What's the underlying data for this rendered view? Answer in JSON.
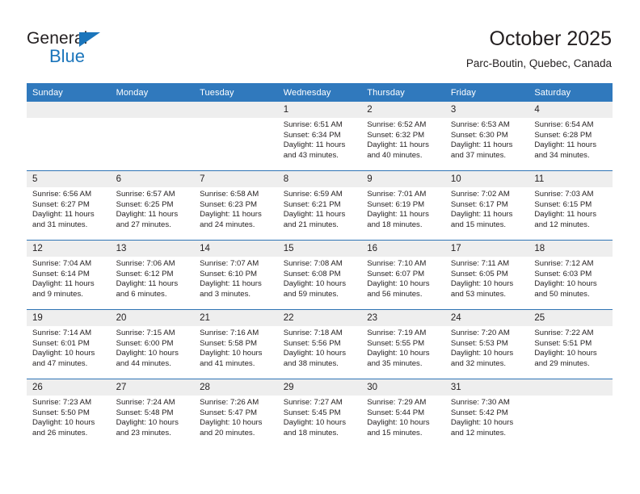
{
  "brand": {
    "name_top": "General",
    "name_bottom": "Blue",
    "accent_color": "#1b75bb",
    "text_color": "#231f20"
  },
  "header": {
    "title": "October 2025",
    "subtitle": "Parc-Boutin, Quebec, Canada"
  },
  "theme": {
    "header_row_bg": "#3079bd",
    "header_row_text": "#ffffff",
    "daynum_bg": "#eeeeee",
    "row_divider": "#2f74b5"
  },
  "weekdays": [
    "Sunday",
    "Monday",
    "Tuesday",
    "Wednesday",
    "Thursday",
    "Friday",
    "Saturday"
  ],
  "weeks": [
    [
      {
        "day": "",
        "blank": true
      },
      {
        "day": "",
        "blank": true
      },
      {
        "day": "",
        "blank": true
      },
      {
        "day": "1",
        "sunrise": "Sunrise: 6:51 AM",
        "sunset": "Sunset: 6:34 PM",
        "daylight_1": "Daylight: 11 hours",
        "daylight_2": "and 43 minutes."
      },
      {
        "day": "2",
        "sunrise": "Sunrise: 6:52 AM",
        "sunset": "Sunset: 6:32 PM",
        "daylight_1": "Daylight: 11 hours",
        "daylight_2": "and 40 minutes."
      },
      {
        "day": "3",
        "sunrise": "Sunrise: 6:53 AM",
        "sunset": "Sunset: 6:30 PM",
        "daylight_1": "Daylight: 11 hours",
        "daylight_2": "and 37 minutes."
      },
      {
        "day": "4",
        "sunrise": "Sunrise: 6:54 AM",
        "sunset": "Sunset: 6:28 PM",
        "daylight_1": "Daylight: 11 hours",
        "daylight_2": "and 34 minutes."
      }
    ],
    [
      {
        "day": "5",
        "sunrise": "Sunrise: 6:56 AM",
        "sunset": "Sunset: 6:27 PM",
        "daylight_1": "Daylight: 11 hours",
        "daylight_2": "and 31 minutes."
      },
      {
        "day": "6",
        "sunrise": "Sunrise: 6:57 AM",
        "sunset": "Sunset: 6:25 PM",
        "daylight_1": "Daylight: 11 hours",
        "daylight_2": "and 27 minutes."
      },
      {
        "day": "7",
        "sunrise": "Sunrise: 6:58 AM",
        "sunset": "Sunset: 6:23 PM",
        "daylight_1": "Daylight: 11 hours",
        "daylight_2": "and 24 minutes."
      },
      {
        "day": "8",
        "sunrise": "Sunrise: 6:59 AM",
        "sunset": "Sunset: 6:21 PM",
        "daylight_1": "Daylight: 11 hours",
        "daylight_2": "and 21 minutes."
      },
      {
        "day": "9",
        "sunrise": "Sunrise: 7:01 AM",
        "sunset": "Sunset: 6:19 PM",
        "daylight_1": "Daylight: 11 hours",
        "daylight_2": "and 18 minutes."
      },
      {
        "day": "10",
        "sunrise": "Sunrise: 7:02 AM",
        "sunset": "Sunset: 6:17 PM",
        "daylight_1": "Daylight: 11 hours",
        "daylight_2": "and 15 minutes."
      },
      {
        "day": "11",
        "sunrise": "Sunrise: 7:03 AM",
        "sunset": "Sunset: 6:15 PM",
        "daylight_1": "Daylight: 11 hours",
        "daylight_2": "and 12 minutes."
      }
    ],
    [
      {
        "day": "12",
        "sunrise": "Sunrise: 7:04 AM",
        "sunset": "Sunset: 6:14 PM",
        "daylight_1": "Daylight: 11 hours",
        "daylight_2": "and 9 minutes."
      },
      {
        "day": "13",
        "sunrise": "Sunrise: 7:06 AM",
        "sunset": "Sunset: 6:12 PM",
        "daylight_1": "Daylight: 11 hours",
        "daylight_2": "and 6 minutes."
      },
      {
        "day": "14",
        "sunrise": "Sunrise: 7:07 AM",
        "sunset": "Sunset: 6:10 PM",
        "daylight_1": "Daylight: 11 hours",
        "daylight_2": "and 3 minutes."
      },
      {
        "day": "15",
        "sunrise": "Sunrise: 7:08 AM",
        "sunset": "Sunset: 6:08 PM",
        "daylight_1": "Daylight: 10 hours",
        "daylight_2": "and 59 minutes."
      },
      {
        "day": "16",
        "sunrise": "Sunrise: 7:10 AM",
        "sunset": "Sunset: 6:07 PM",
        "daylight_1": "Daylight: 10 hours",
        "daylight_2": "and 56 minutes."
      },
      {
        "day": "17",
        "sunrise": "Sunrise: 7:11 AM",
        "sunset": "Sunset: 6:05 PM",
        "daylight_1": "Daylight: 10 hours",
        "daylight_2": "and 53 minutes."
      },
      {
        "day": "18",
        "sunrise": "Sunrise: 7:12 AM",
        "sunset": "Sunset: 6:03 PM",
        "daylight_1": "Daylight: 10 hours",
        "daylight_2": "and 50 minutes."
      }
    ],
    [
      {
        "day": "19",
        "sunrise": "Sunrise: 7:14 AM",
        "sunset": "Sunset: 6:01 PM",
        "daylight_1": "Daylight: 10 hours",
        "daylight_2": "and 47 minutes."
      },
      {
        "day": "20",
        "sunrise": "Sunrise: 7:15 AM",
        "sunset": "Sunset: 6:00 PM",
        "daylight_1": "Daylight: 10 hours",
        "daylight_2": "and 44 minutes."
      },
      {
        "day": "21",
        "sunrise": "Sunrise: 7:16 AM",
        "sunset": "Sunset: 5:58 PM",
        "daylight_1": "Daylight: 10 hours",
        "daylight_2": "and 41 minutes."
      },
      {
        "day": "22",
        "sunrise": "Sunrise: 7:18 AM",
        "sunset": "Sunset: 5:56 PM",
        "daylight_1": "Daylight: 10 hours",
        "daylight_2": "and 38 minutes."
      },
      {
        "day": "23",
        "sunrise": "Sunrise: 7:19 AM",
        "sunset": "Sunset: 5:55 PM",
        "daylight_1": "Daylight: 10 hours",
        "daylight_2": "and 35 minutes."
      },
      {
        "day": "24",
        "sunrise": "Sunrise: 7:20 AM",
        "sunset": "Sunset: 5:53 PM",
        "daylight_1": "Daylight: 10 hours",
        "daylight_2": "and 32 minutes."
      },
      {
        "day": "25",
        "sunrise": "Sunrise: 7:22 AM",
        "sunset": "Sunset: 5:51 PM",
        "daylight_1": "Daylight: 10 hours",
        "daylight_2": "and 29 minutes."
      }
    ],
    [
      {
        "day": "26",
        "sunrise": "Sunrise: 7:23 AM",
        "sunset": "Sunset: 5:50 PM",
        "daylight_1": "Daylight: 10 hours",
        "daylight_2": "and 26 minutes."
      },
      {
        "day": "27",
        "sunrise": "Sunrise: 7:24 AM",
        "sunset": "Sunset: 5:48 PM",
        "daylight_1": "Daylight: 10 hours",
        "daylight_2": "and 23 minutes."
      },
      {
        "day": "28",
        "sunrise": "Sunrise: 7:26 AM",
        "sunset": "Sunset: 5:47 PM",
        "daylight_1": "Daylight: 10 hours",
        "daylight_2": "and 20 minutes."
      },
      {
        "day": "29",
        "sunrise": "Sunrise: 7:27 AM",
        "sunset": "Sunset: 5:45 PM",
        "daylight_1": "Daylight: 10 hours",
        "daylight_2": "and 18 minutes."
      },
      {
        "day": "30",
        "sunrise": "Sunrise: 7:29 AM",
        "sunset": "Sunset: 5:44 PM",
        "daylight_1": "Daylight: 10 hours",
        "daylight_2": "and 15 minutes."
      },
      {
        "day": "31",
        "sunrise": "Sunrise: 7:30 AM",
        "sunset": "Sunset: 5:42 PM",
        "daylight_1": "Daylight: 10 hours",
        "daylight_2": "and 12 minutes."
      },
      {
        "day": "",
        "blank": true
      }
    ]
  ]
}
